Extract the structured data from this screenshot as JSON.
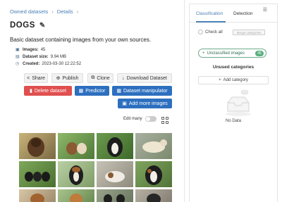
{
  "breadcrumb": {
    "parent": "Owned datasets",
    "separator": "›",
    "current": "Details",
    "trailing": "›"
  },
  "dataset": {
    "title": "DOGS",
    "description": "Basic dataset containing images from your own sources.",
    "images_label": "Images:",
    "images_value": "45",
    "size_label": "Dataset size:",
    "size_value": "9.94 MB",
    "created_label": "Created:",
    "created_value": "2023-03-30 12:22:52"
  },
  "actions": {
    "share": "Share",
    "publish": "Publish",
    "clone": "Clone",
    "download": "Download Dataset",
    "delete": "Delete dataset",
    "predictor": "Predictor",
    "manipulator": "Dataset manipulator",
    "add_images": "Add more images"
  },
  "gallery": {
    "edit_many_label": "Edit many",
    "edit_many_on": false
  },
  "panel": {
    "tabs": [
      "Classification",
      "Detection"
    ],
    "check_all": "Check all",
    "merge_label": "Merge categories",
    "unclassified_label": "Unclassified images",
    "unclassified_count": "45",
    "unused_title": "Unused categories",
    "add_category": "Add category",
    "empty_text": "No Data"
  },
  "colors": {
    "accent": "#4a7fb5",
    "danger": "#e04f4f",
    "primary": "#2d6fbf",
    "success": "#5ab07e"
  }
}
